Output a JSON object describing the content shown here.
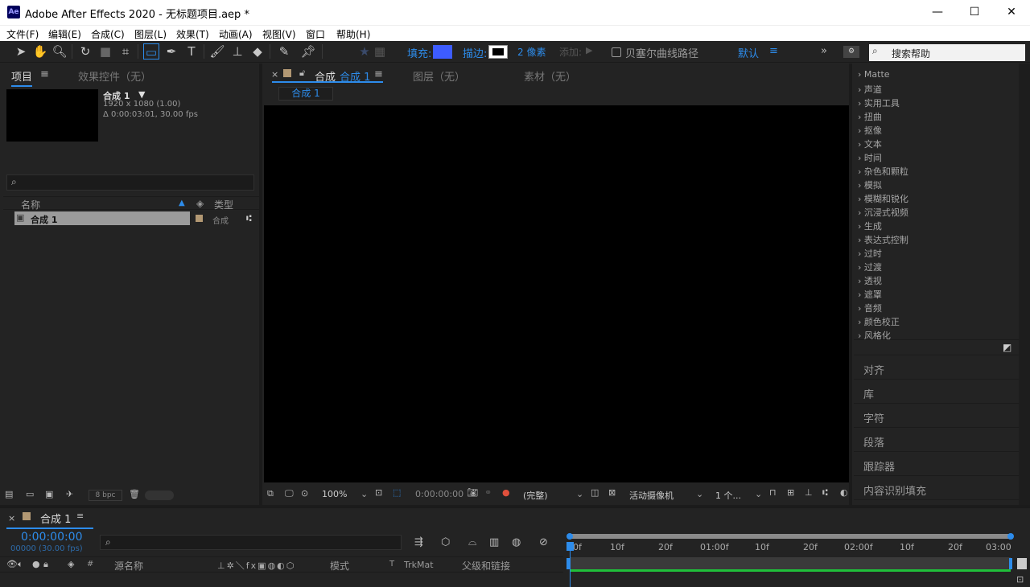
{
  "window": {
    "title": "Adobe After Effects 2020 - 无标题项目.aep *",
    "logo": "Ae",
    "minimize": "—",
    "maximize": "☐",
    "close": "✕"
  },
  "menu": [
    "文件(F)",
    "编辑(E)",
    "合成(C)",
    "图层(L)",
    "效果(T)",
    "动画(A)",
    "视图(V)",
    "窗口",
    "帮助(H)"
  ],
  "toolbar": {
    "fill_label": "填充:",
    "stroke_label": "描边:",
    "stroke_width": "2 像素",
    "add_label": "添加:",
    "bezier_label": "贝塞尔曲线路径",
    "workspace": "默认",
    "search_placeholder": "搜索帮助",
    "fill_color": "#3d5cff"
  },
  "project": {
    "tab": "项目",
    "effects_tab": "效果控件（无）",
    "comp_name": "合成 1",
    "comp_res": "1920 x 1080 (1.00)",
    "comp_dur": "Δ 0:00:03:01, 30.00 fps",
    "col_name": "名称",
    "col_type": "类型",
    "item_name": "合成 1",
    "item_type": "合成",
    "bpc": "8 bpc"
  },
  "viewer": {
    "tab_prefix": "合成",
    "tab_comp": "合成 1",
    "layer_tab": "图层（无）",
    "footage_tab": "素材（无）",
    "subtab": "合成 1",
    "zoom": "100%",
    "timecode": "0:00:00:00",
    "quality": "(完整)",
    "camera": "活动摄像机",
    "views": "1 个..."
  },
  "effects": {
    "items": [
      "Matte",
      "声道",
      "实用工具",
      "扭曲",
      "抠像",
      "文本",
      "时间",
      "杂色和颗粒",
      "模拟",
      "模糊和锐化",
      "沉浸式视频",
      "生成",
      "表达式控制",
      "过时",
      "过渡",
      "透视",
      "遮罩",
      "音频",
      "颜色校正",
      "风格化"
    ]
  },
  "side_panels": [
    "对齐",
    "库",
    "字符",
    "段落",
    "跟踪器",
    "内容识别填充"
  ],
  "timeline": {
    "tab": "合成 1",
    "timecode": "0:00:00:00",
    "fps": "00000 (30.00 fps)",
    "col_source": "源名称",
    "col_mode": "模式",
    "col_t": "T",
    "col_trkmat": "TrkMat",
    "col_parent": "父级和链接",
    "col_hash": "#",
    "ruler": [
      "0f",
      "10f",
      "20f",
      "01:00f",
      "10f",
      "20f",
      "02:00f",
      "10f",
      "20f",
      "03:00"
    ]
  }
}
